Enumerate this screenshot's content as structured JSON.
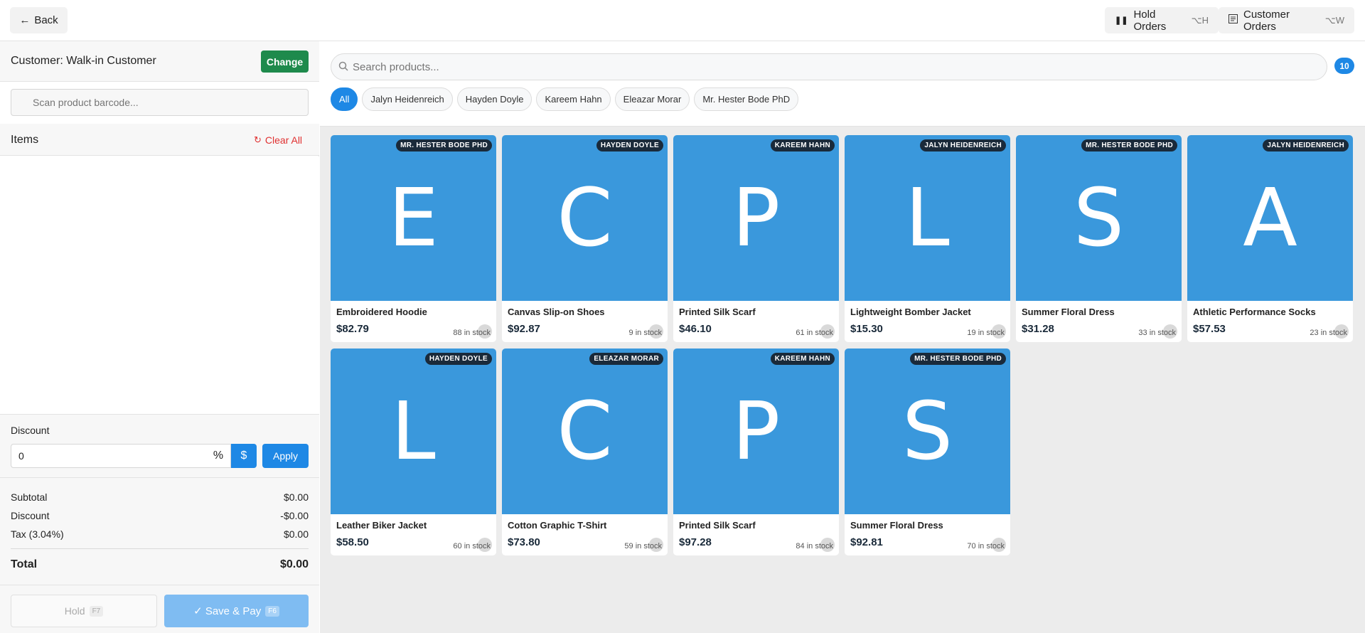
{
  "topbar": {
    "back_label": "Back",
    "hold_orders_label": "Hold Orders",
    "hold_orders_shortcut": "⌥H",
    "customer_orders_label": "Customer Orders",
    "customer_orders_shortcut": "⌥W"
  },
  "customer": {
    "label": "Customer: Walk-in Customer",
    "change_label": "Change"
  },
  "barcode": {
    "placeholder": "Scan product barcode..."
  },
  "items": {
    "title": "Items",
    "clear_label": "Clear All"
  },
  "discount": {
    "label": "Discount",
    "value": "0",
    "percent_label": "%",
    "dollar_label": "$",
    "apply_label": "Apply"
  },
  "totals": {
    "subtotal_label": "Subtotal",
    "subtotal_value": "$0.00",
    "discount_label": "Discount",
    "discount_value": "-$0.00",
    "tax_label": "Tax (3.04%)",
    "tax_value": "$0.00",
    "total_label": "Total",
    "total_value": "$0.00"
  },
  "actions": {
    "hold_label": "Hold",
    "hold_shortcut": "F7",
    "save_label": "✓ Save & Pay",
    "save_shortcut": "F6"
  },
  "search": {
    "placeholder": "Search products...",
    "count": "10"
  },
  "filters": [
    "All",
    "Jalyn Heidenreich",
    "Hayden Doyle",
    "Kareem Hahn",
    "Eleazar Morar",
    "Mr. Hester Bode PhD"
  ],
  "products": [
    {
      "letter": "E",
      "tag": "MR. HESTER BODE PHD",
      "name": "Embroidered Hoodie",
      "price": "$82.79",
      "stock": "88 in stock"
    },
    {
      "letter": "C",
      "tag": "HAYDEN DOYLE",
      "name": "Canvas Slip-on Shoes",
      "price": "$92.87",
      "stock": "9 in stock"
    },
    {
      "letter": "P",
      "tag": "KAREEM HAHN",
      "name": "Printed Silk Scarf",
      "price": "$46.10",
      "stock": "61 in stock"
    },
    {
      "letter": "L",
      "tag": "JALYN HEIDENREICH",
      "name": "Lightweight Bomber Jacket",
      "price": "$15.30",
      "stock": "19 in stock"
    },
    {
      "letter": "S",
      "tag": "MR. HESTER BODE PHD",
      "name": "Summer Floral Dress",
      "price": "$31.28",
      "stock": "33 in stock"
    },
    {
      "letter": "A",
      "tag": "JALYN HEIDENREICH",
      "name": "Athletic Performance Socks",
      "price": "$57.53",
      "stock": "23 in stock"
    },
    {
      "letter": "L",
      "tag": "HAYDEN DOYLE",
      "name": "Leather Biker Jacket",
      "price": "$58.50",
      "stock": "60 in stock"
    },
    {
      "letter": "C",
      "tag": "ELEAZAR MORAR",
      "name": "Cotton Graphic T-Shirt",
      "price": "$73.80",
      "stock": "59 in stock"
    },
    {
      "letter": "P",
      "tag": "KAREEM HAHN",
      "name": "Printed Silk Scarf",
      "price": "$97.28",
      "stock": "84 in stock"
    },
    {
      "letter": "S",
      "tag": "MR. HESTER BODE PHD",
      "name": "Summer Floral Dress",
      "price": "$92.81",
      "stock": "70 in stock"
    }
  ],
  "colors": {
    "accent": "#1e88e5",
    "change": "#1e8a4c",
    "thumb": "#3a98dc",
    "danger": "#e03131"
  }
}
